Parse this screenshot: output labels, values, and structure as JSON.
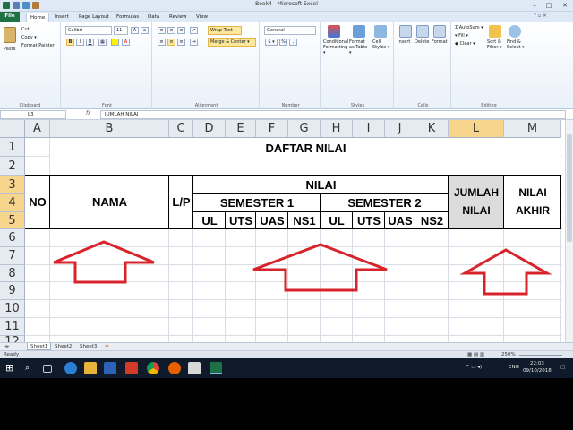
{
  "window": {
    "title": "Book4 - Microsoft Excel",
    "min": "–",
    "max": "□",
    "close": "✕"
  },
  "tabs": {
    "file": "File",
    "items": [
      "Home",
      "Insert",
      "Page Layout",
      "Formulas",
      "Data",
      "Review",
      "View"
    ]
  },
  "ribbon": {
    "clipboard": {
      "label": "Clipboard",
      "paste": "Paste",
      "cut": "Cut",
      "copy": "Copy ▾",
      "format_painter": "Format Painter"
    },
    "font": {
      "label": "Font",
      "name": "Calibri",
      "size": "11",
      "bold": "B",
      "italic": "I",
      "underline": "U"
    },
    "alignment": {
      "label": "Alignment",
      "wrap": "Wrap Text",
      "merge": "Merge & Center ▾"
    },
    "number": {
      "label": "Number",
      "format": "General",
      "currency": "$ ▾",
      "percent": "%",
      "comma": ","
    },
    "styles": {
      "label": "Styles",
      "conditional": "Conditional Formatting ▾",
      "table": "Format as Table ▾",
      "cell": "Cell Styles ▾"
    },
    "cells": {
      "label": "Cells",
      "insert": "Insert",
      "delete": "Delete",
      "format": "Format"
    },
    "editing": {
      "label": "Editing",
      "autosum": "AutoSum ▾",
      "fill": "Fill ▾",
      "clear": "Clear ▾",
      "sort": "Sort & Filter ▾",
      "find": "Find & Select ▾"
    }
  },
  "formula_bar": {
    "name_box": "L3",
    "fx": "fx",
    "content": "JUMLAH NILAI"
  },
  "columns": [
    "A",
    "B",
    "C",
    "D",
    "E",
    "F",
    "G",
    "H",
    "I",
    "J",
    "K",
    "L",
    "M"
  ],
  "rows": [
    "1",
    "2",
    "3",
    "4",
    "5",
    "6",
    "7",
    "8",
    "9",
    "10",
    "11",
    "12"
  ],
  "cells": {
    "title": "DAFTAR NILAI",
    "no": "NO",
    "nama": "NAMA",
    "lp": "L/P",
    "nilai": "NILAI",
    "semester1": "SEMESTER 1",
    "semester2": "SEMESTER 2",
    "jumlah1": "JUMLAH",
    "jumlah2": "NILAI",
    "akhir1": "NILAI",
    "akhir2": "AKHIR",
    "sub": [
      "UL",
      "UTS",
      "UAS",
      "NS1",
      "UL",
      "UTS",
      "UAS",
      "NS2"
    ]
  },
  "sheets": [
    "Sheet1",
    "Sheet2",
    "Sheet3"
  ],
  "status": {
    "ready": "Ready",
    "zoom": "250%"
  },
  "taskbar": {
    "time": "22:03",
    "date": "09/10/2018",
    "lang": "ENG"
  },
  "colors": {
    "excel_green": "#1e7145",
    "arrow_red": "#d9232a",
    "selected_header": "#f8d58c"
  }
}
